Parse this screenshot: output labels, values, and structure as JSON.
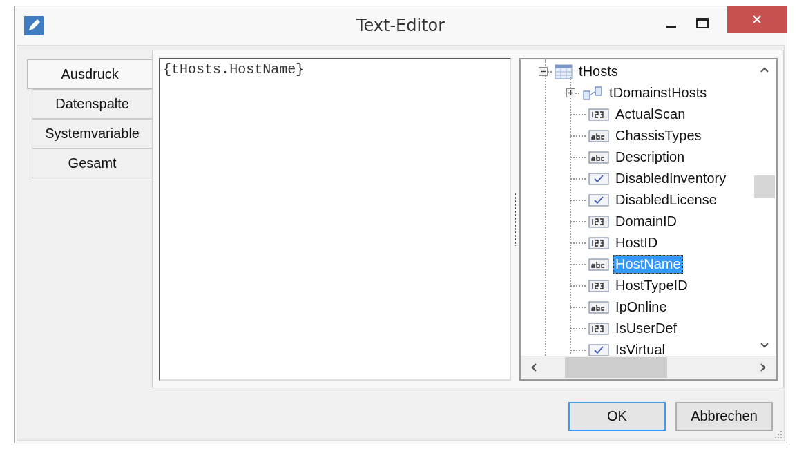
{
  "window": {
    "title": "Text-Editor"
  },
  "tabs": [
    {
      "label": "Ausdruck",
      "selected": true
    },
    {
      "label": "Datenspalte",
      "selected": false
    },
    {
      "label": "Systemvariable",
      "selected": false
    },
    {
      "label": "Gesamt",
      "selected": false
    }
  ],
  "editor": {
    "value": "{tHosts.HostName}"
  },
  "tree": {
    "root": {
      "label": "tHosts",
      "expanded": true,
      "children": [
        {
          "label": "tDomainstHosts",
          "kind": "relation",
          "expanded": false,
          "selected": false
        },
        {
          "label": "ActualScan",
          "kind": "number",
          "selected": false
        },
        {
          "label": "ChassisTypes",
          "kind": "text",
          "selected": false
        },
        {
          "label": "Description",
          "kind": "text",
          "selected": false
        },
        {
          "label": "DisabledInventory",
          "kind": "bool",
          "selected": false
        },
        {
          "label": "DisabledLicense",
          "kind": "bool",
          "selected": false
        },
        {
          "label": "DomainID",
          "kind": "number",
          "selected": false
        },
        {
          "label": "HostID",
          "kind": "number",
          "selected": false
        },
        {
          "label": "HostName",
          "kind": "text",
          "selected": true
        },
        {
          "label": "HostTypeID",
          "kind": "number",
          "selected": false
        },
        {
          "label": "IpOnline",
          "kind": "text",
          "selected": false
        },
        {
          "label": "IsUserDef",
          "kind": "number",
          "selected": false
        },
        {
          "label": "IsVirtual",
          "kind": "bool",
          "selected": false
        }
      ]
    }
  },
  "buttons": [
    {
      "label": "OK",
      "default": true
    },
    {
      "label": "Abbrechen",
      "default": false
    }
  ]
}
